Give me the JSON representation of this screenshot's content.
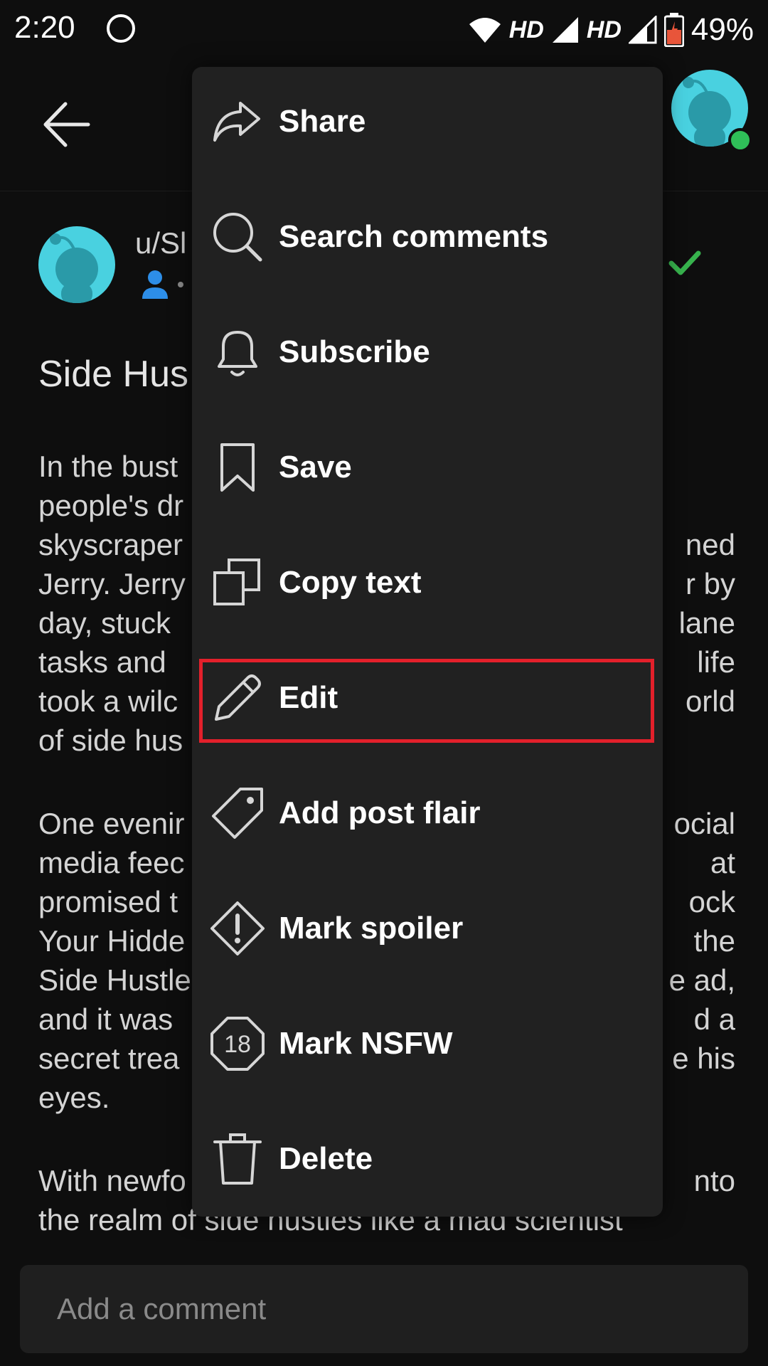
{
  "status_bar": {
    "time": "2:20",
    "hd1": "HD",
    "hd2": "HD",
    "battery": "49%"
  },
  "post": {
    "username": "u/Sl",
    "title": "Side Hus",
    "paragraph1": [
      {
        "left": "In the bust",
        "right": ""
      },
      {
        "left": "people's dr",
        "right": ""
      },
      {
        "left": "skyscraper",
        "right": "ned"
      },
      {
        "left": "Jerry. Jerry",
        "right": "r by"
      },
      {
        "left": "day, stuck",
        "right": "lane"
      },
      {
        "left": "tasks and",
        "right": "life"
      },
      {
        "left": "took a wilc",
        "right": "orld"
      },
      {
        "left": "of side hus",
        "right": ""
      }
    ],
    "paragraph2": [
      {
        "left": "One evenir",
        "right": "ocial"
      },
      {
        "left": "media feec",
        "right": "at"
      },
      {
        "left": "promised t",
        "right": "ock"
      },
      {
        "left": "Your Hidde",
        "right": "the"
      },
      {
        "left": "Side Hustle",
        "right": "e ad,"
      },
      {
        "left": "and it was",
        "right": "d a"
      },
      {
        "left": "secret trea",
        "right": "e his"
      },
      {
        "left": "eyes.",
        "right": ""
      }
    ],
    "paragraph3": [
      {
        "left": "With newfo",
        "right": "nto"
      },
      {
        "left": "the realm of side hustles like a mad scientist",
        "right": ""
      }
    ]
  },
  "menu": {
    "items": [
      {
        "label": "Share",
        "icon": "share-icon"
      },
      {
        "label": "Search comments",
        "icon": "search-icon"
      },
      {
        "label": "Subscribe",
        "icon": "bell-icon"
      },
      {
        "label": "Save",
        "icon": "bookmark-icon"
      },
      {
        "label": "Copy text",
        "icon": "copy-icon"
      },
      {
        "label": "Edit",
        "icon": "pencil-icon"
      },
      {
        "label": "Add post flair",
        "icon": "tag-icon"
      },
      {
        "label": "Mark spoiler",
        "icon": "spoiler-icon"
      },
      {
        "label": "Mark NSFW",
        "icon": "nsfw-18-icon"
      },
      {
        "label": "Delete",
        "icon": "trash-icon"
      }
    ],
    "highlighted_item": "Edit",
    "highlight_color": "#e3202b"
  },
  "comment": {
    "placeholder": "Add a comment"
  },
  "colors": {
    "background": "#0e0e0e",
    "menu_background": "#212121",
    "avatar": "#49d1e0",
    "online": "#2fbf58",
    "check": "#37b24d",
    "user_icon": "#2d8ee8"
  }
}
